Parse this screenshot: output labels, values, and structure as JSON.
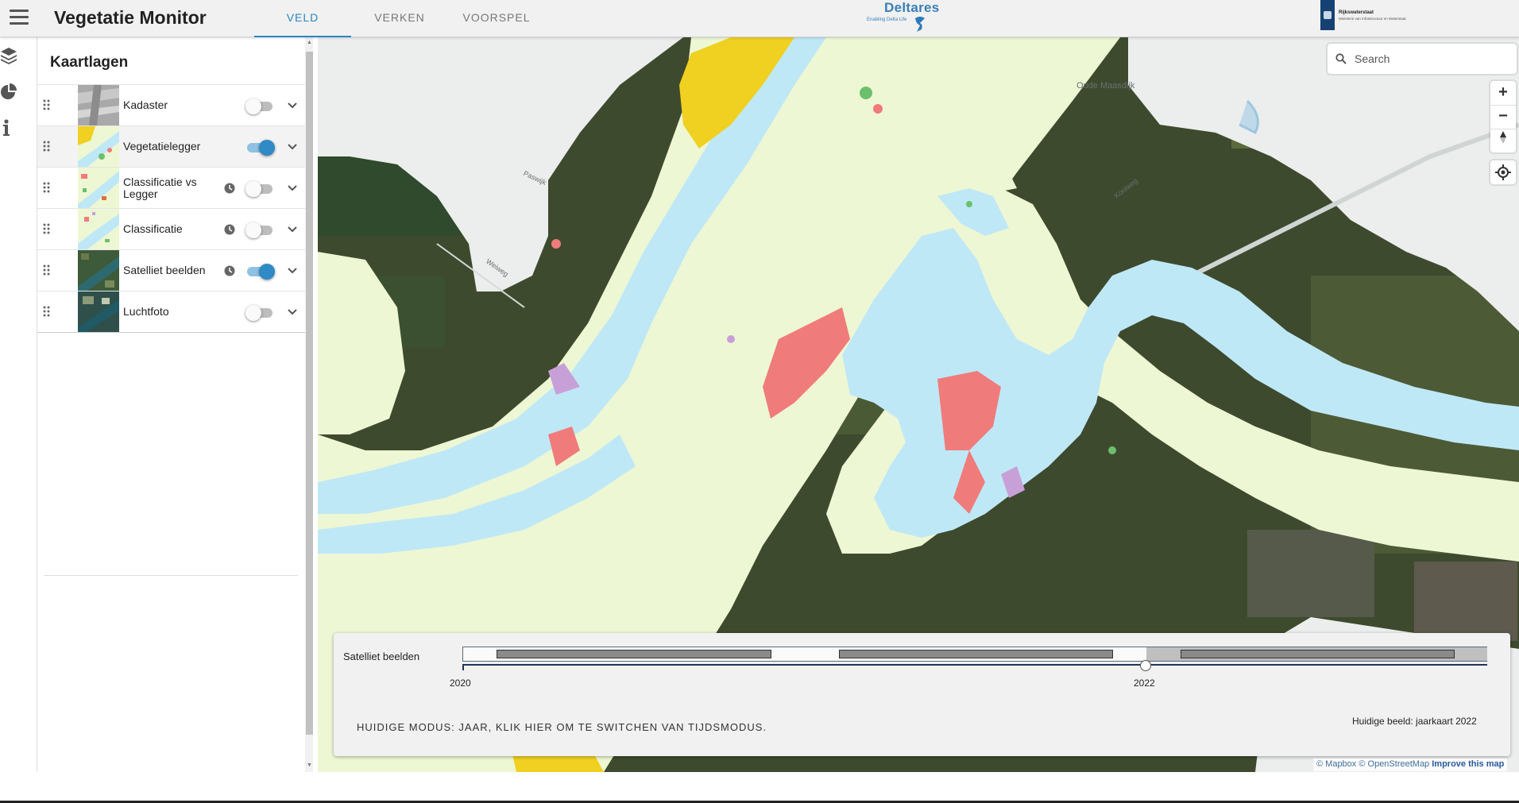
{
  "app": {
    "title": "Vegetatie Monitor"
  },
  "tabs": [
    {
      "label": "VELD",
      "active": true
    },
    {
      "label": "VERKEN",
      "active": false
    },
    {
      "label": "VOORSPEL",
      "active": false
    }
  ],
  "logos": {
    "deltares": {
      "name": "Deltares",
      "tagline": "Enabling Delta Life"
    },
    "rijkswaterstaat": {
      "name": "Rijkswaterstaat",
      "subtitle": "Ministerie van Infrastructuur en Waterstaat"
    }
  },
  "rail": {
    "icons": [
      "layers-icon",
      "pie-chart-icon",
      "info-icon"
    ]
  },
  "panel": {
    "title": "Kaartlagen",
    "layers": [
      {
        "name": "Kadaster",
        "enabled": false,
        "has_time": false
      },
      {
        "name": "Vegetatielegger",
        "enabled": true,
        "has_time": false
      },
      {
        "name": "Classificatie vs Legger",
        "enabled": false,
        "has_time": true
      },
      {
        "name": "Classificatie",
        "enabled": false,
        "has_time": true
      },
      {
        "name": "Satelliet beelden",
        "enabled": true,
        "has_time": true
      },
      {
        "name": "Luchtfoto",
        "enabled": false,
        "has_time": false
      }
    ]
  },
  "map": {
    "search_placeholder": "Search",
    "zoom_in": "+",
    "zoom_out": "−",
    "place_labels": [
      "Oude Maasdijk",
      "Kooiweg",
      "Paswijk",
      "Weiweg"
    ],
    "attribution": {
      "mapbox": "© Mapbox",
      "osm": "© OpenStreetMap",
      "improve": "Improve this map"
    }
  },
  "timeline": {
    "label": "Satelliet beelden",
    "years": [
      "2020",
      "2022"
    ],
    "selected_year": "2022",
    "mode_text": "HUIDIGE MODUS: JAAR, KLIK HIER OM TE SWITCHEN VAN TIJDSMODUS.",
    "current_image": "Huidige beeld: jaarkaart 2022"
  },
  "colors": {
    "accent": "#2a86c4",
    "water": "#bfe8f7",
    "floodplain": "#eef7d3",
    "reed": "#f0d020",
    "hardwood": "#f07b7b"
  }
}
